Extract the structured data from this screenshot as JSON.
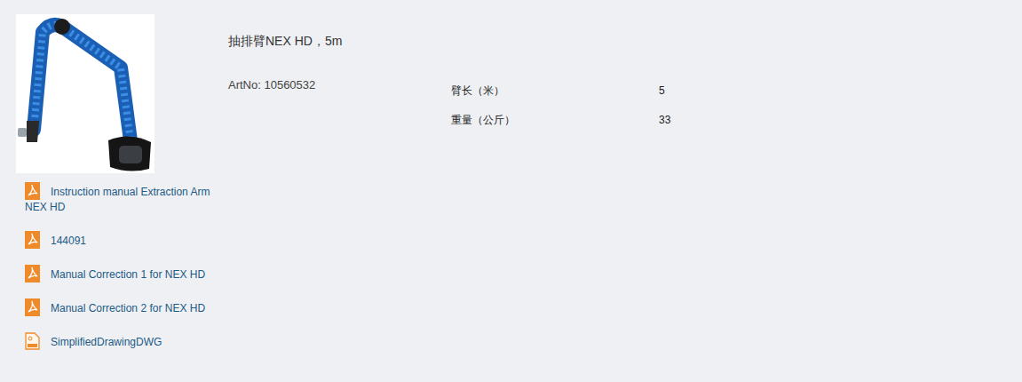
{
  "product": {
    "title": "抽排臂NEX HD，5m",
    "art_no": "ArtNo: 10560532"
  },
  "downloads": [
    {
      "label": "Instruction manual Extraction Arm NEX HD",
      "kind": "pdf"
    },
    {
      "label": "144091",
      "kind": "pdf"
    },
    {
      "label": "Manual Correction 1 for NEX HD",
      "kind": "pdf"
    },
    {
      "label": "Manual Correction 2 for NEX HD",
      "kind": "pdf"
    },
    {
      "label": "SimplifiedDrawingDWG",
      "kind": "dwg"
    }
  ],
  "specs": [
    {
      "label": "臂长（米）",
      "value": "5"
    },
    {
      "label": "重量（公斤）",
      "value": "33"
    }
  ]
}
